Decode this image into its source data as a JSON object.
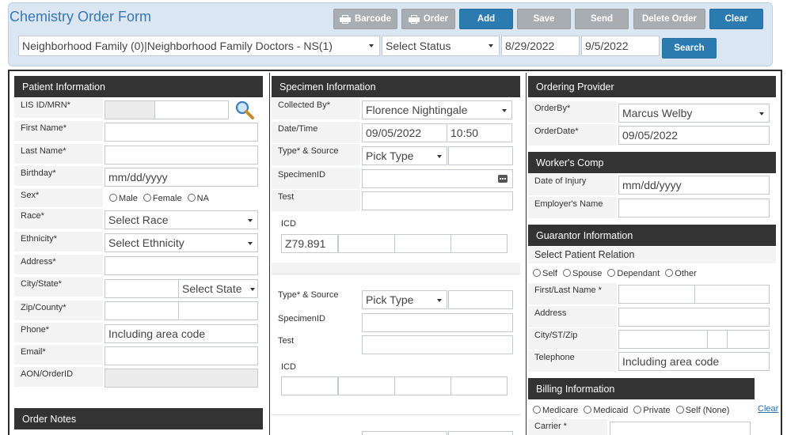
{
  "header": {
    "title": "Chemistry Order Form",
    "buttons": {
      "barcode": "Barcode",
      "order": "Order",
      "add": "Add",
      "save": "Save",
      "send": "Send",
      "delete": "Delete Order",
      "clear": "Clear"
    },
    "practice": "Neighborhood Family (0)|Neighborhood Family Doctors - NS(1)",
    "status": "Select Status",
    "date_from": "8/29/2022",
    "date_to": "9/5/2022",
    "search": "Search"
  },
  "patient": {
    "header": "Patient Information",
    "lis_label": "LIS ID/MRN*",
    "first_label": "First Name*",
    "last_label": "Last Name*",
    "birthday_label": "Birthday*",
    "birthday_placeholder": "mm/dd/yyyy",
    "sex_label": "Sex*",
    "sex_options": [
      "Male",
      "Female",
      "NA"
    ],
    "race_label": "Race*",
    "race_value": "Select Race",
    "ethnicity_label": "Ethnicity*",
    "ethnicity_value": "Select Ethnicity",
    "address_label": "Address*",
    "city_label": "City/State*",
    "state_value": "Select State",
    "zip_label": "Zip/County*",
    "phone_label": "Phone*",
    "phone_placeholder": "Including area code",
    "email_label": "Email*",
    "aon_label": "AON/OrderID"
  },
  "order_notes": {
    "header": "Order Notes"
  },
  "specimen": {
    "header": "Specimen Information",
    "collected_label": "Collected By*",
    "collected_value": "Florence Nightingale",
    "datetime_label": "Date/Time",
    "date_value": "09/05/2022",
    "time_value": "10:50",
    "type_label": "Type* & Source",
    "type_value": "Pick Type",
    "specimenid_label": "SpecimenID",
    "test_label": "Test",
    "icd_label": "ICD",
    "icd_value": "Z79.891",
    "type2_label": "Type* & Source",
    "type2_value": "Pick Type",
    "specimenid2_label": "SpecimenID",
    "test2_label": "Test",
    "icd2_label": "ICD"
  },
  "provider": {
    "header": "Ordering Provider",
    "orderby_label": "OrderBy*",
    "orderby_value": "Marcus Welby",
    "orderdate_label": "OrderDate*",
    "orderdate_value": "09/05/2022"
  },
  "workers": {
    "header": "Worker's Comp",
    "injury_label": "Date of Injury",
    "injury_placeholder": "mm/dd/yyyy",
    "employer_label": "Employer's Name"
  },
  "guarantor": {
    "header": "Guarantor Information",
    "relation_label": "Select Patient Relation",
    "relation_options": [
      "Self",
      "Spouse",
      "Dependant",
      "Other"
    ],
    "name_label": "First/Last Name *",
    "address_label": "Address",
    "city_label": "City/ST/Zip",
    "phone_label": "Telephone",
    "phone_placeholder": "Including area code"
  },
  "billing": {
    "header": "Billing Information",
    "options": [
      "Medicare",
      "Medicaid",
      "Private",
      "Self (None)"
    ],
    "clear": "Clear",
    "carrier_label": "Carrier *"
  }
}
